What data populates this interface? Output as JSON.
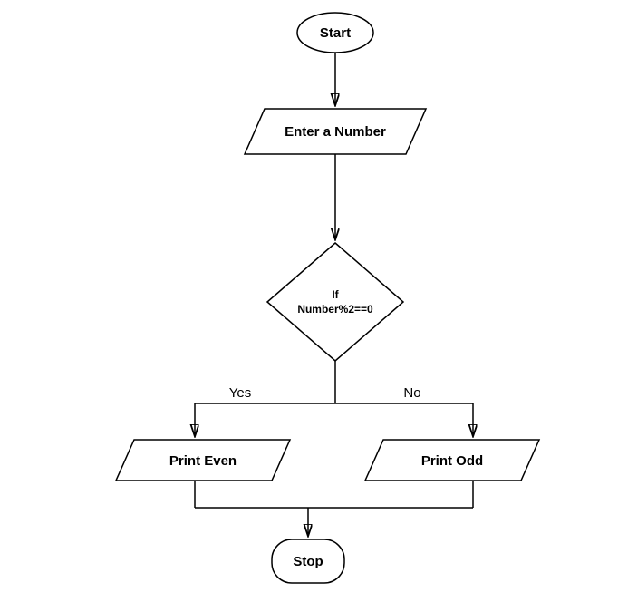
{
  "flowchart": {
    "start": "Start",
    "input": "Enter a Number",
    "decision_line1": "If",
    "decision_line2": "Number%2==0",
    "yes_label": "Yes",
    "no_label": "No",
    "yes_action": "Print Even",
    "no_action": "Print Odd",
    "stop": "Stop"
  }
}
